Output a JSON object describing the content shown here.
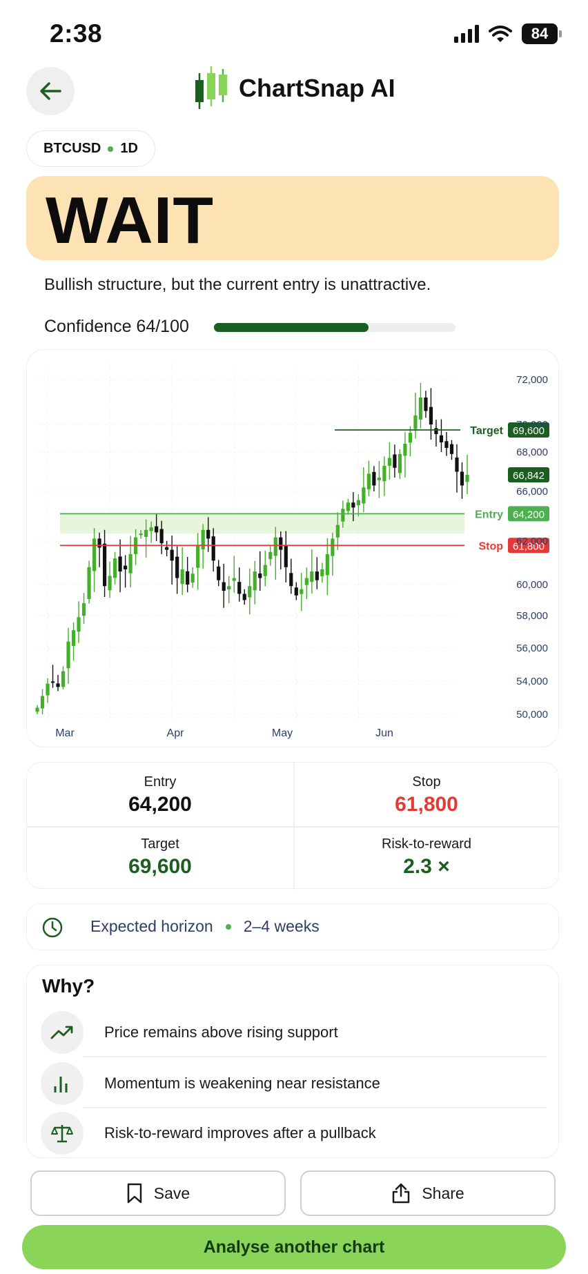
{
  "status_bar": {
    "time": "2:38",
    "battery": "84"
  },
  "header": {
    "app_title": "ChartSnap AI"
  },
  "pair": {
    "symbol": "BTCUSD",
    "timeframe": "1D"
  },
  "verdict": {
    "label": "WAIT",
    "color": "#fde2b4"
  },
  "summary": "Bullish structure, but the current entry is unattractive.",
  "confidence": {
    "label": "Confidence 64/100",
    "value": 64,
    "max": 100
  },
  "chart_data": {
    "type": "candlestick",
    "x_tick_labels": [
      "Mar",
      "Apr",
      "May",
      "Jun"
    ],
    "y_tick_labels": [
      "72,000",
      "70,000",
      "68,000",
      "66,000",
      "62,000",
      "60,000",
      "58,000",
      "56,000",
      "54,000",
      "50,000"
    ],
    "ylim": [
      50000,
      72500
    ],
    "grid": true,
    "levels": [
      {
        "name": "Target",
        "value": 69600,
        "value_label": "69,600",
        "color": "#1b5e20"
      },
      {
        "name": "Entry",
        "value": 64200,
        "value_label": "64,200",
        "color": "#4caf50",
        "zone": [
          62600,
          64200
        ]
      },
      {
        "name": "Stop",
        "value": 61800,
        "value_label": "61,800",
        "color": "#e53935"
      }
    ],
    "current_price": {
      "value": 66842,
      "label": "66,842"
    },
    "close_series_approx": [
      50800,
      52200,
      53700,
      53900,
      53300,
      54600,
      56400,
      57100,
      57900,
      58800,
      60800,
      62200,
      61700,
      59900,
      60400,
      61200,
      60600,
      60700,
      61400,
      62300,
      62600,
      62900,
      63100,
      62700,
      61900,
      61600,
      61100,
      60300,
      60700,
      60000,
      60500,
      61800,
      62900,
      62200,
      61100,
      60200,
      59600,
      59900,
      60300,
      59400,
      59000,
      59900,
      60600,
      60300,
      60900,
      61500,
      62300,
      61600,
      60800,
      59900,
      59300,
      59700,
      60300,
      60600,
      60200,
      60700,
      61400,
      62200,
      63300,
      64600,
      65100,
      64700,
      65300,
      66200,
      66900,
      66300,
      66700,
      67300,
      67700,
      67200,
      67900,
      68600,
      69400,
      70400,
      71200,
      70600,
      70000,
      69300,
      68700,
      68300,
      67900,
      67000,
      66300,
      66842
    ]
  },
  "stats": {
    "entry": {
      "label": "Entry",
      "value": "64,200",
      "color": "#111111"
    },
    "stop": {
      "label": "Stop",
      "value": "61,800",
      "color": "#e53935"
    },
    "target": {
      "label": "Target",
      "value": "69,600",
      "color": "#1b5e20"
    },
    "rr": {
      "label": "Risk-to-reward",
      "value": "2.3 ×",
      "color": "#1b5e20"
    }
  },
  "horizon": {
    "label": "Expected horizon",
    "value": "2–4 weeks"
  },
  "why": {
    "title": "Why?",
    "reasons": [
      {
        "icon": "trend-up-icon",
        "text": "Price remains above rising support"
      },
      {
        "icon": "bar-chart-icon",
        "text": "Momentum is weakening near resistance"
      },
      {
        "icon": "scale-icon",
        "text": "Risk-to-reward improves after a pullback"
      }
    ]
  },
  "actions": {
    "save": "Save",
    "share": "Share",
    "primary": "Analyse another chart"
  }
}
